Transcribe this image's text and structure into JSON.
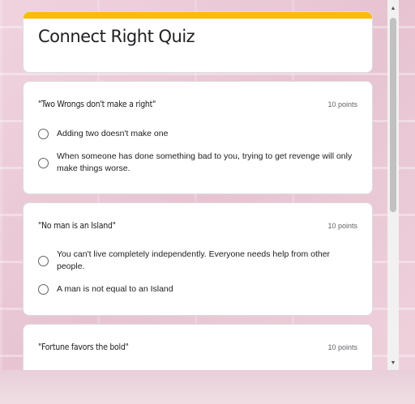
{
  "form": {
    "title": "Connect Right Quiz",
    "accent_color": "#fbbc04"
  },
  "questions": [
    {
      "title": "\"Two Wrongs don't make a right\"",
      "points": "10 points",
      "options": [
        "Adding two doesn't make one",
        "When someone has done something bad to you, trying to get revenge will only make things worse."
      ]
    },
    {
      "title": "\"No man is an Island\"",
      "points": "10 points",
      "options": [
        "You can't live completely independently. Everyone needs help from other people.",
        "A man is not equal to an Island"
      ]
    },
    {
      "title": "\"Fortune favors the bold\"",
      "points": "10 points",
      "options": []
    }
  ],
  "scrollbar": {
    "up_icon": "triangle-up-icon",
    "down_icon": "triangle-down-icon"
  }
}
